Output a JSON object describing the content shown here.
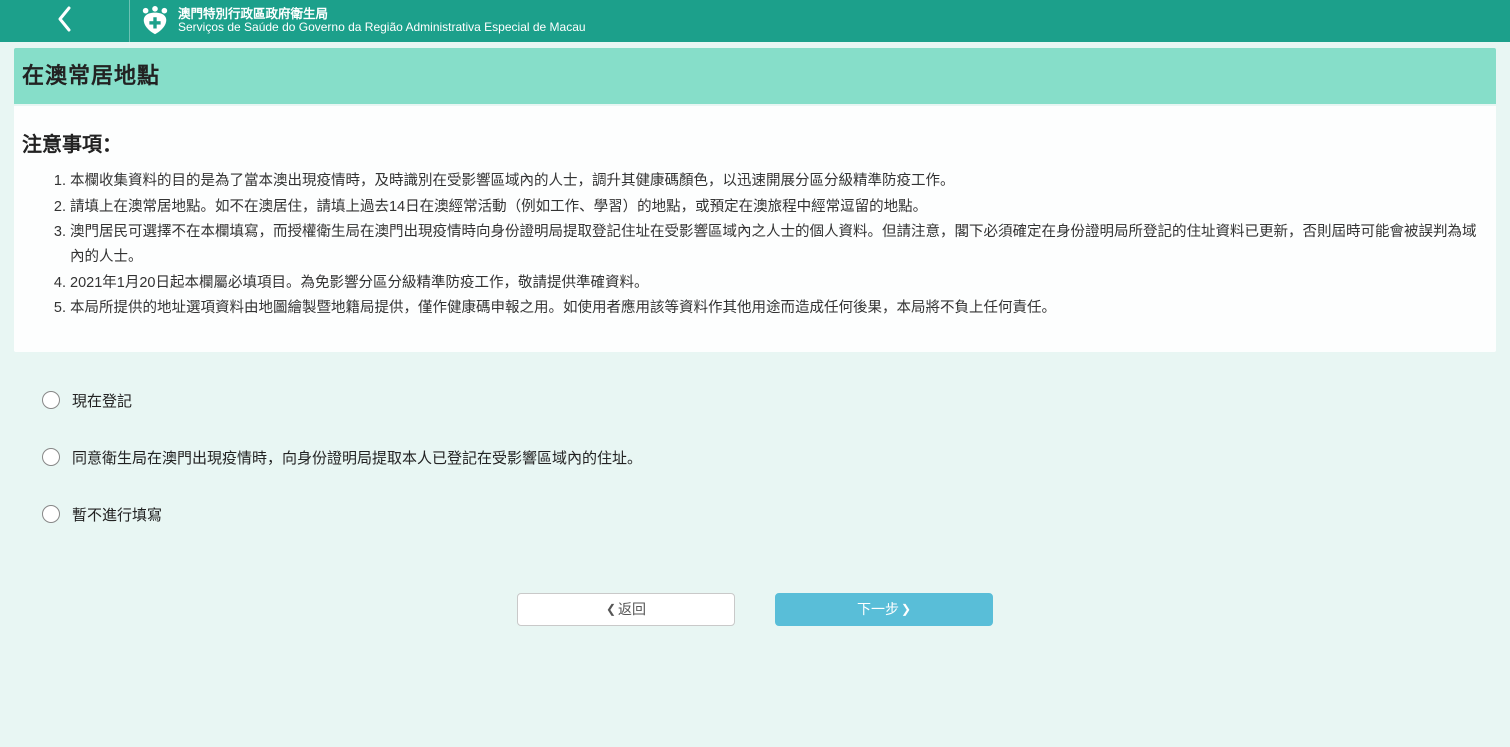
{
  "header": {
    "org_zh": "澳門特別行政區政府衛生局",
    "org_pt": "Serviços de Saúde do Governo da Região Administrativa Especial de Macau"
  },
  "page_title": "在澳常居地點",
  "notice": {
    "heading": "注意事項：",
    "items": [
      "本欄收集資料的目的是為了當本澳出現疫情時，及時識別在受影響區域內的人士，調升其健康碼顏色，以迅速開展分區分級精準防疫工作。",
      "請填上在澳常居地點。如不在澳居住，請填上過去14日在澳經常活動（例如工作、學習）的地點，或預定在澳旅程中經常逗留的地點。",
      "澳門居民可選擇不在本欄填寫，而授權衛生局在澳門出現疫情時向身份證明局提取登記住址在受影響區域內之人士的個人資料。但請注意，閣下必須確定在身份證明局所登記的住址資料已更新，否則屆時可能會被誤判為域內的人士。",
      "2021年1月20日起本欄屬必填項目。為免影響分區分級精準防疫工作，敬請提供準確資料。",
      "本局所提供的地址選項資料由地圖繪製暨地籍局提供，僅作健康碼申報之用。如使用者應用該等資料作其他用途而造成任何後果，本局將不負上任何責任。"
    ]
  },
  "options": [
    "現在登記",
    "同意衛生局在澳門出現疫情時，向身份證明局提取本人已登記在受影響區域內的住址。",
    "暫不進行填寫"
  ],
  "nav": {
    "back_label": "返回",
    "next_label": "下一步"
  }
}
